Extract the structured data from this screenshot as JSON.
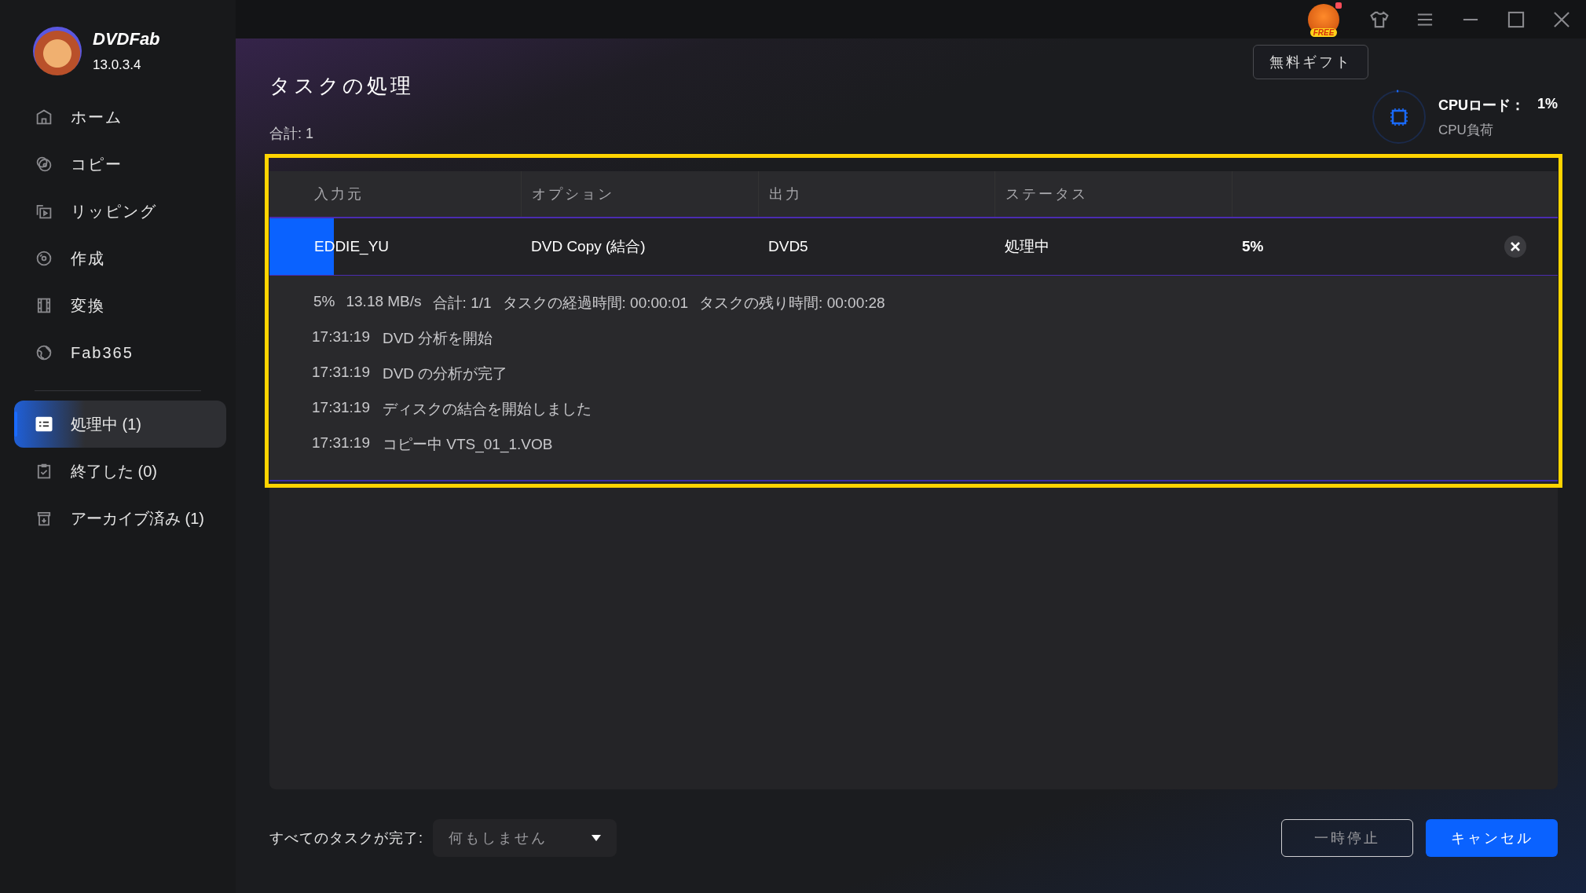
{
  "app": {
    "name": "DVDFab",
    "version": "13.0.3.4"
  },
  "nav": [
    {
      "label": "ホーム"
    },
    {
      "label": "コピー"
    },
    {
      "label": "リッピング"
    },
    {
      "label": "作成"
    },
    {
      "label": "変換"
    },
    {
      "label": "Fab365"
    }
  ],
  "queues": [
    {
      "label": "処理中 (1)",
      "selected": true
    },
    {
      "label": "終了した (0)",
      "selected": false
    },
    {
      "label": "アーカイブ済み (1)",
      "selected": false
    }
  ],
  "top_bar": {
    "free_badge": "FREE",
    "gift_tooltip": "無料ギフト"
  },
  "cpu": {
    "title": "CPUロード：",
    "value": "1%",
    "subtitle": "CPU負荷",
    "level": 0.01
  },
  "page_title": "タスクの処理",
  "total": "合計: 1",
  "table": {
    "columns": [
      "入力元",
      "オプション",
      "出力",
      "ステータス"
    ],
    "rows": [
      {
        "source": "EDDIE_YU",
        "option": "DVD Copy (結合)",
        "output": "DVD5",
        "status": "処理中",
        "percent": "5%",
        "level": 0.05,
        "stats": [
          "5%",
          "13.18 MB/s",
          "合計: 1/1",
          "タスクの経過時間: 00:00:01",
          "タスクの残り時間: 00:00:28"
        ],
        "log": [
          {
            "time": "17:31:19",
            "message": "DVD 分析を開始"
          },
          {
            "time": "17:31:19",
            "message": "DVD の分析が完了"
          },
          {
            "time": "17:31:19",
            "message": "ディスクの結合を開始しました"
          },
          {
            "time": "17:31:19",
            "message": "コピー中 VTS_01_1.VOB"
          }
        ]
      }
    ]
  },
  "footer": {
    "label": "すべてのタスクが完了:",
    "dropdown": "何もしません",
    "buttons": [
      {
        "label": "一時停止",
        "kind": "secondary"
      },
      {
        "label": "キャンセル",
        "kind": "primary"
      }
    ]
  }
}
